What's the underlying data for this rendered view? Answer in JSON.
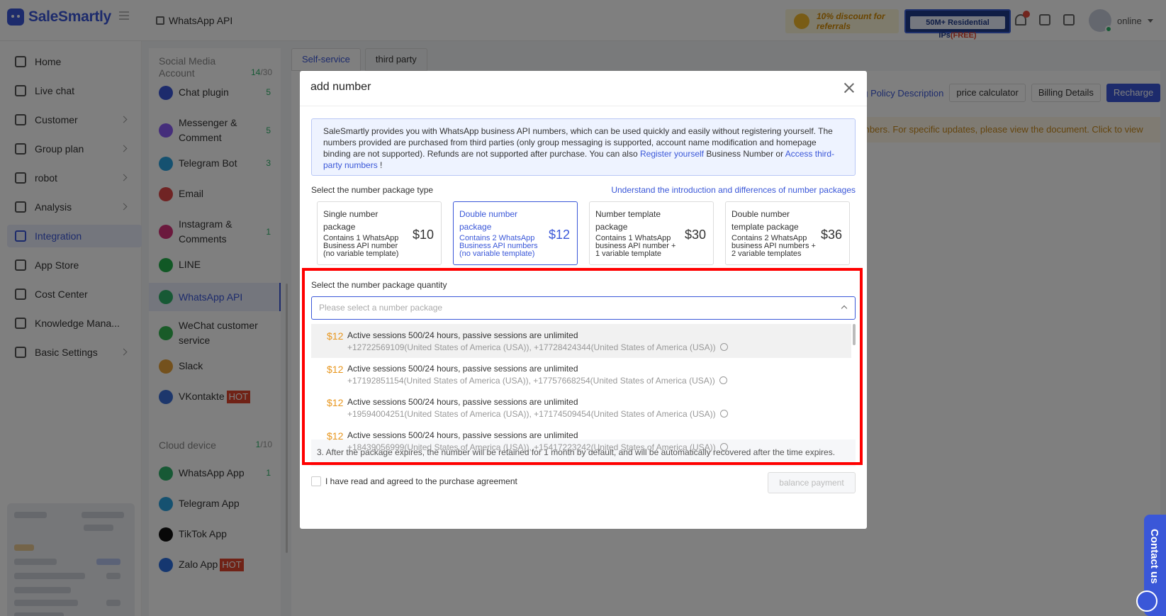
{
  "header": {
    "logo_text": "SaleSmartly",
    "breadcrumb": "WhatsApp API",
    "promo_referral": "10% discount for referrals",
    "promo_ips": "50M+ Residential IPs",
    "promo_ips_free": "(FREE)",
    "user_status": "online"
  },
  "sidebar": {
    "items": [
      {
        "label": "Home",
        "icon": "home-icon"
      },
      {
        "label": "Live chat",
        "icon": "chat-icon"
      },
      {
        "label": "Customer",
        "icon": "users-icon"
      },
      {
        "label": "Group plan",
        "icon": "send-icon"
      },
      {
        "label": "robot",
        "icon": "robot-icon"
      },
      {
        "label": "Analysis",
        "icon": "chart-icon"
      },
      {
        "label": "Integration",
        "icon": "integration-icon"
      },
      {
        "label": "App Store",
        "icon": "apps-icon"
      },
      {
        "label": "Cost Center",
        "icon": "wallet-icon"
      },
      {
        "label": "Knowledge Mana...",
        "icon": "book-icon"
      },
      {
        "label": "Basic Settings",
        "icon": "gear-icon"
      }
    ]
  },
  "panel": {
    "social_header": "Social Media Account",
    "social_count": "14",
    "social_total": "/30",
    "items": [
      {
        "label": "Chat plugin",
        "count": "5"
      },
      {
        "label": "Messenger & Comment",
        "count": "5"
      },
      {
        "label": "Telegram Bot",
        "count": "3"
      },
      {
        "label": "Email",
        "count": ""
      },
      {
        "label": "Instagram & Comments",
        "count": "1"
      },
      {
        "label": "LINE",
        "count": ""
      },
      {
        "label": "WhatsApp API",
        "count": ""
      },
      {
        "label": "WeChat customer service",
        "count": ""
      },
      {
        "label": "Slack",
        "count": ""
      },
      {
        "label": "VKontakte",
        "count": "",
        "badge": "HOT"
      }
    ],
    "cloud_header": "Cloud device",
    "cloud_count": "1",
    "cloud_total": "/10",
    "cloud_items": [
      {
        "label": "WhatsApp App",
        "count": "1"
      },
      {
        "label": "Telegram App",
        "count": ""
      },
      {
        "label": "TikTok App",
        "count": ""
      },
      {
        "label": "Zalo App",
        "count": "",
        "badge": "HOT"
      }
    ]
  },
  "main": {
    "tabs": [
      "Self-service",
      "third party"
    ],
    "policy_link": "ng Policy Description",
    "price_calculator": "price calculator",
    "billing_details": "Billing Details",
    "recharge": "Recharge",
    "notice": "mbers. For specific updates, please view the document. Click to view"
  },
  "modal": {
    "title": "add number",
    "info_text_1": "SaleSmartly provides you with WhatsApp business API numbers, which can be used quickly and easily without registering yourself. The numbers provided are purchased from third parties (only group messaging is supported, account name modification and homepage binding are not supported). Refunds are not supported after purchase. You can also ",
    "info_link_1": "Register yourself",
    "info_text_2": " Business Number or ",
    "info_link_2": "Access third-party numbers",
    "info_text_3": " !",
    "type_label": "Select the number package type",
    "type_link": "Understand the introduction and differences of number packages",
    "packages": [
      {
        "name": "Single number package",
        "desc": "Contains 1 WhatsApp Business API number (no variable template)",
        "price": "$10"
      },
      {
        "name": "Double number package",
        "desc": "Contains 2 WhatsApp Business API numbers (no variable template)",
        "price": "$12"
      },
      {
        "name": "Number template package",
        "desc": "Contains 1 WhatsApp business API number + 1 variable template",
        "price": "$30"
      },
      {
        "name": "Double number template package",
        "desc": "Contains 2 WhatsApp business API numbers + 2 variable templates",
        "price": "$36"
      }
    ],
    "selected_package": "Double number package",
    "quantity_label": "Select the number package quantity",
    "quantity_placeholder": "Please select a number package",
    "options": [
      {
        "price": "$12",
        "title": "Active sessions 500/24 hours, passive sessions are unlimited",
        "numbers": "+12722569109(United States of America (USA)),  +17728424344(United States of America (USA))"
      },
      {
        "price": "$12",
        "title": "Active sessions 500/24 hours, passive sessions are unlimited",
        "numbers": "+17192851154(United States of America (USA)),  +17757668254(United States of America (USA))"
      },
      {
        "price": "$12",
        "title": "Active sessions 500/24 hours, passive sessions are unlimited",
        "numbers": "+19594004251(United States of America (USA)),  +17174509454(United States of America (USA))"
      },
      {
        "price": "$12",
        "title": "Active sessions 500/24 hours, passive sessions are unlimited",
        "numbers": "+18439056999(United States of America (USA)),  +15417223242(United States of America (USA))"
      }
    ],
    "tip_3": "3. After the package expires, the number will be retained for 1 month by default, and will be automatically recovered after the time expires.",
    "agree_label": "I have read and agreed to the purchase agreement",
    "pay_button": "balance payment"
  },
  "contact": {
    "label": "Contact us"
  },
  "colors": {
    "accent": "#3a57d8",
    "price": "#e8961d",
    "highlight": "#ff0000",
    "success": "#2fb36b",
    "hot": "#e0442d"
  }
}
